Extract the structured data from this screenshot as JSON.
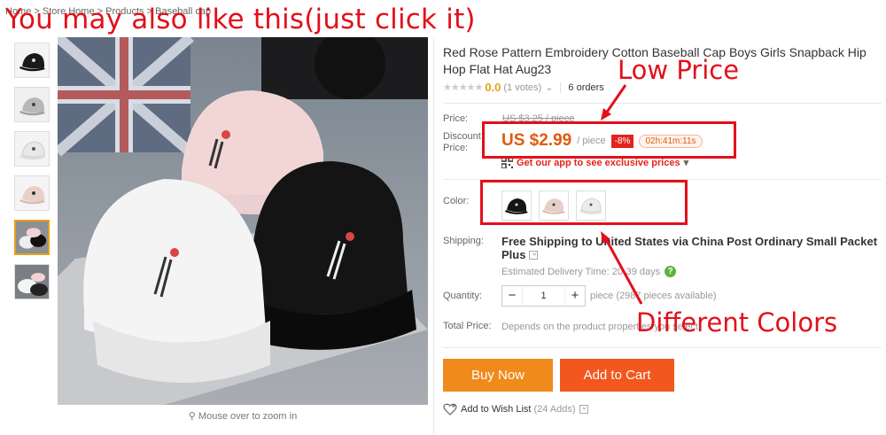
{
  "breadcrumb": [
    "Home",
    "Store Home",
    "Products",
    "Baseball cap"
  ],
  "overlay_title": "You may also like this(just click it)",
  "product": {
    "title": "Red Rose Pattern Embroidery Cotton Baseball Cap Boys Girls Snapback Hip Hop Flat Hat Aug23",
    "rating_score": "0.0",
    "votes": "(1 votes)",
    "orders": "6 orders"
  },
  "price": {
    "label": "Price:",
    "original": "US $3.25 / piece",
    "discount_label": "Discount Price:",
    "current": "US $2.99",
    "per": "/ piece",
    "discount_badge": "-8%",
    "countdown": "02h:41m:11s",
    "app_promo": "Get our app to see exclusive prices"
  },
  "color": {
    "label": "Color:",
    "options": [
      "black",
      "pink",
      "white"
    ]
  },
  "shipping": {
    "label": "Shipping:",
    "line1": "Free Shipping to United States via China Post Ordinary Small Packet",
    "line2": "Plus",
    "delivery": "Estimated Delivery Time: 20-39 days"
  },
  "quantity": {
    "label": "Quantity:",
    "value": "1",
    "minus": "−",
    "plus": "+",
    "note": "piece (2987 pieces available)"
  },
  "total": {
    "label": "Total Price:",
    "text": "Depends on the product properties you select"
  },
  "actions": {
    "buy_now": "Buy Now",
    "add_to_cart": "Add to Cart",
    "wishlist": "Add to Wish List",
    "wishlist_count": "(24 Adds)"
  },
  "image": {
    "zoom_hint": "Mouse over to zoom in"
  },
  "annotations": {
    "low_price": "Low Price",
    "different_colors": "Different Colors"
  },
  "colors": {
    "annotation_red": "#e3101a",
    "price_orange": "#e15a0a",
    "buy_now_bg": "#f08a1a",
    "add_to_cart_bg": "#f2571d"
  }
}
